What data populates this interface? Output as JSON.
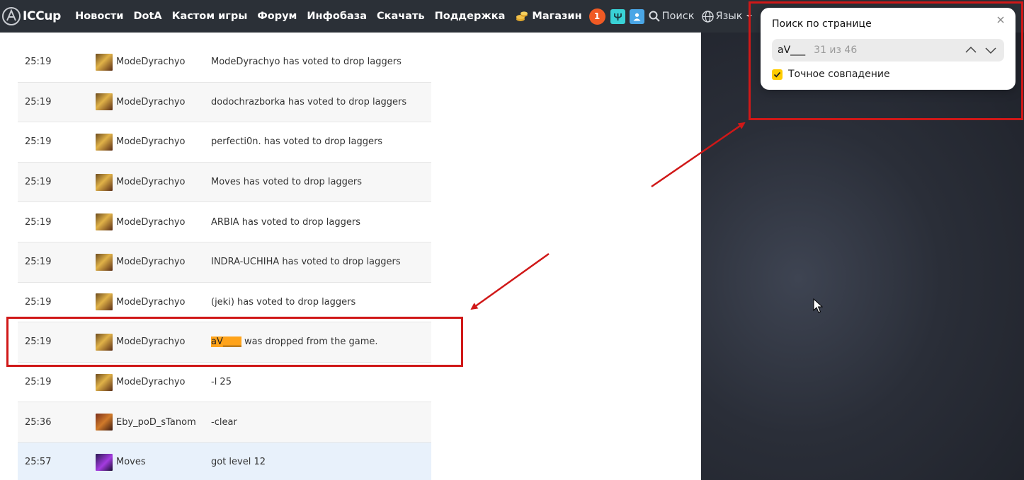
{
  "nav": {
    "logo_text": "ICCup",
    "items": [
      "Новости",
      "DotA",
      "Кастом игры",
      "Форум",
      "Инфобаза",
      "Скачать",
      "Поддержка"
    ],
    "shop_label": "Магазин",
    "notification_count": "1",
    "search_label": "Поиск",
    "language_label": "Язык"
  },
  "log": {
    "rows": [
      {
        "time": "25:19",
        "player": "ModeDyrachyo",
        "message": "ModeDyrachyo has voted to drop laggers"
      },
      {
        "time": "25:19",
        "player": "ModeDyrachyo",
        "message": "dodochrazborka has voted to drop laggers"
      },
      {
        "time": "25:19",
        "player": "ModeDyrachyo",
        "message": "perfecti0n. has voted to drop laggers"
      },
      {
        "time": "25:19",
        "player": "ModeDyrachyo",
        "message": "Moves has voted to drop laggers"
      },
      {
        "time": "25:19",
        "player": "ModeDyrachyo",
        "message": "ARBIA has voted to drop laggers"
      },
      {
        "time": "25:19",
        "player": "ModeDyrachyo",
        "message": "INDRA-UCHIHA has voted to drop laggers"
      },
      {
        "time": "25:19",
        "player": "ModeDyrachyo",
        "message": "(jeki) has voted to drop laggers"
      },
      {
        "time": "25:19",
        "player": "ModeDyrachyo",
        "message_mark": "aV____",
        "message_rest": " was dropped from the game."
      },
      {
        "time": "25:19",
        "player": "ModeDyrachyo",
        "message": "-l 25"
      },
      {
        "time": "25:36",
        "player": "Eby_poD_sTanom",
        "message": "-clear"
      },
      {
        "time": "25:57",
        "player": "Moves",
        "message": "got level 12"
      }
    ]
  },
  "find": {
    "title": "Поиск по странице",
    "query": "aV___",
    "count": "31 из 46",
    "exact_match_label": "Точное совпадение",
    "exact_match_checked": true
  },
  "colors": {
    "nav_bg": "#2b3037",
    "highlight": "#ffa31a",
    "annotation": "#d01818",
    "checkbox": "#ffcc00",
    "badge": "#f05a24"
  }
}
